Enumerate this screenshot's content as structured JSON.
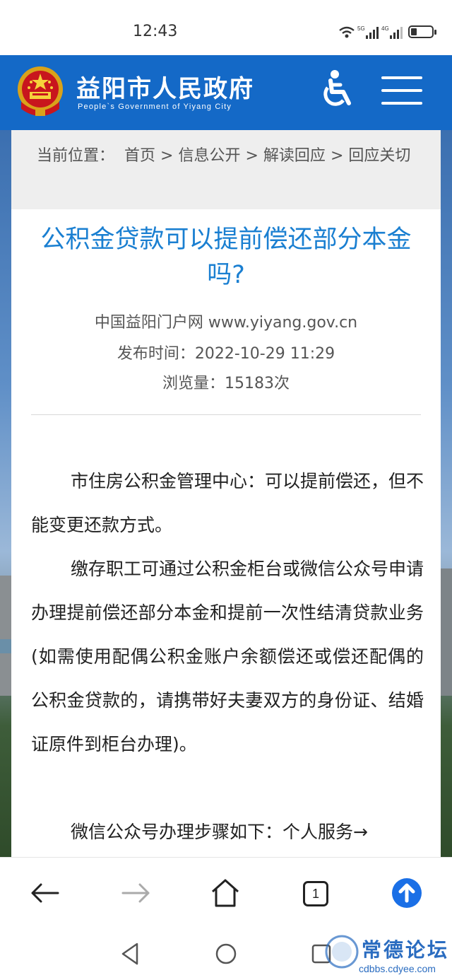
{
  "status_bar": {
    "time": "12:43",
    "net1": "5G",
    "net2": "4G"
  },
  "header": {
    "site_title": "益阳市人民政府",
    "site_subtitle": "People`s Government of Yiyang City",
    "accent_color": "#1469c7"
  },
  "breadcrumb": {
    "prefix": "当前位置：",
    "items": [
      "首页",
      "信息公开",
      "解读回应",
      "回应关切"
    ],
    "separator": ">"
  },
  "article": {
    "title": "公积金贷款可以提前偿还部分本金吗?",
    "source": "中国益阳门户网 www.yiyang.gov.cn",
    "publish": "发布时间：2022-10-29 11:29",
    "views": "浏览量：15183次",
    "paragraphs": [
      "市住房公积金管理中心：可以提前偿还，但不能变更还款方式。",
      "缴存职工可通过公积金柜台或微信公众号申请办理提前偿还部分本金和提前一次性结清贷款业务(如需使用配偶公积金账户余额偿还或偿还配偶的公积金贷款的，请携带好夫妻双方的身份证、结婚证原件到柜台办理)。",
      "微信公众号办理步骤如下：个人服务→"
    ],
    "title_color": "#1a7fd1"
  },
  "browser_bar": {
    "tab_count": "1",
    "icons": [
      "back-arrow-icon",
      "forward-arrow-icon",
      "home-icon",
      "tabs-icon",
      "upload-icon"
    ]
  },
  "watermark": {
    "text": "常德论坛",
    "url": "cdbbs.cdyee.com"
  }
}
